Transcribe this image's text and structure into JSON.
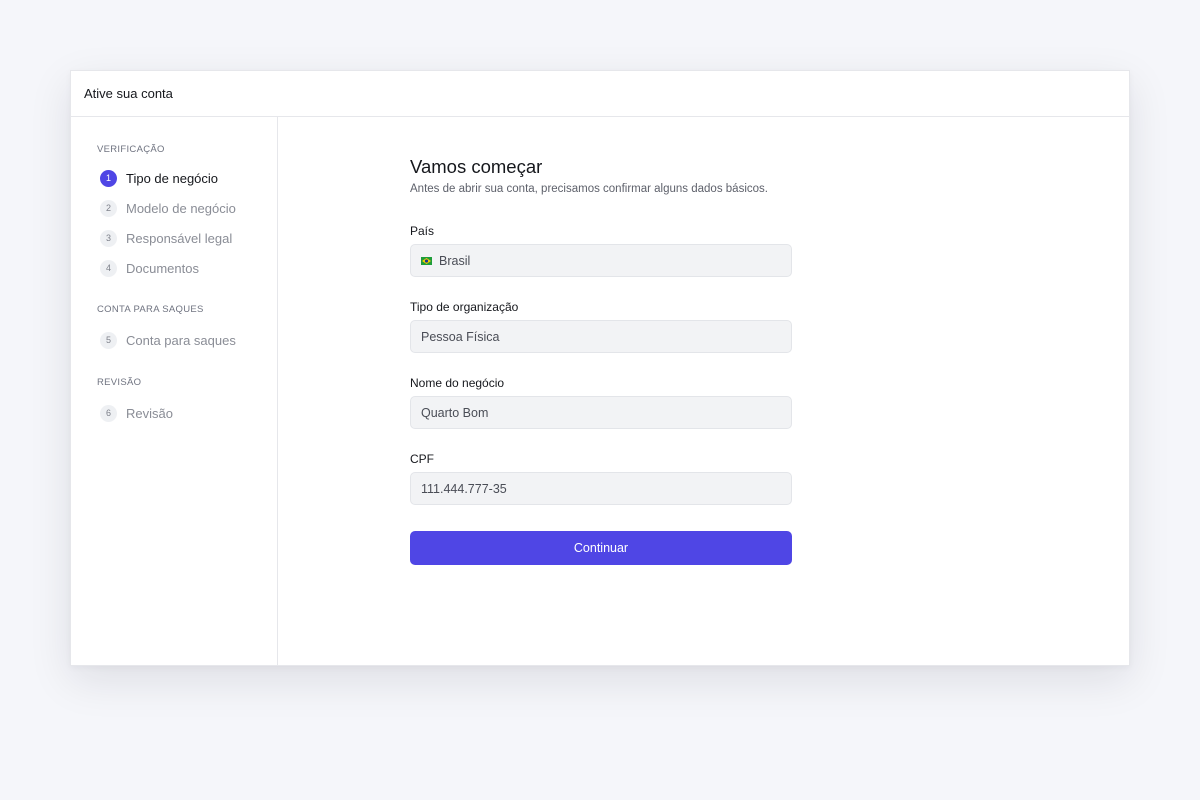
{
  "window": {
    "title": "Ative sua conta"
  },
  "sidebar": {
    "sections": [
      {
        "label": "VERIFICAÇÃO",
        "steps": [
          {
            "num": "1",
            "label": "Tipo de negócio",
            "active": true
          },
          {
            "num": "2",
            "label": "Modelo de negócio",
            "active": false
          },
          {
            "num": "3",
            "label": "Responsável legal",
            "active": false
          },
          {
            "num": "4",
            "label": "Documentos",
            "active": false
          }
        ]
      },
      {
        "label": "CONTA PARA SAQUES",
        "steps": [
          {
            "num": "5",
            "label": "Conta para saques",
            "active": false
          }
        ]
      },
      {
        "label": "REVISÃO",
        "steps": [
          {
            "num": "6",
            "label": "Revisão",
            "active": false
          }
        ]
      }
    ]
  },
  "form": {
    "title": "Vamos começar",
    "subtitle": "Antes de abrir sua conta, precisamos confirmar alguns dados básicos.",
    "fields": [
      {
        "label": "País",
        "value": "Brasil",
        "icon": "brazil-flag-icon"
      },
      {
        "label": "Tipo de organização",
        "value": "Pessoa Física"
      },
      {
        "label": "Nome do negócio",
        "value": "Quarto Bom"
      },
      {
        "label": "CPF",
        "value": "111.444.777-35"
      }
    ],
    "submit_label": "Continuar"
  },
  "colors": {
    "accent": "#4f46e5",
    "background": "#f5f6fa",
    "input_bg": "#f2f3f5"
  }
}
